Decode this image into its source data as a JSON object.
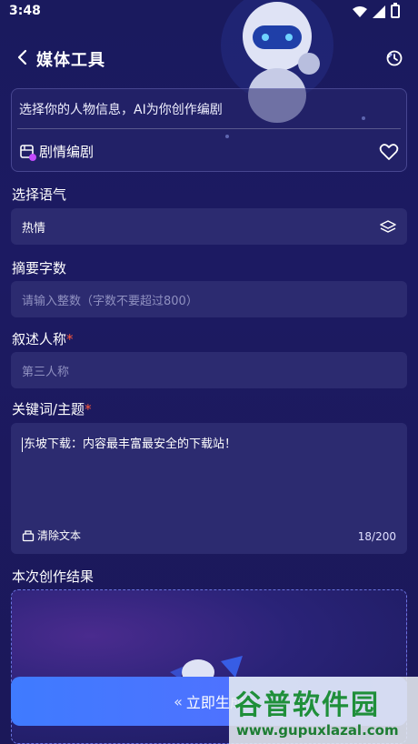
{
  "status": {
    "time": "3:48"
  },
  "header": {
    "title": "媒体工具"
  },
  "profile": {
    "hint": "选择你的人物信息，AI为你创作编剧",
    "role": "剧情编剧"
  },
  "tone": {
    "label": "选择语气",
    "value": "热情"
  },
  "summary": {
    "label": "摘要字数",
    "placeholder": "请输入整数（字数不要超过800）"
  },
  "narration": {
    "label": "叙述人称",
    "required_mark": "*",
    "placeholder": "第三人称"
  },
  "keywords": {
    "label": "关键词/主题",
    "required_mark": "*",
    "value": "东坡下载：内容最丰富最安全的下载站！",
    "clear_label": "清除文本",
    "count": "18/200"
  },
  "result": {
    "label": "本次创作结果"
  },
  "generate": {
    "label": "立即生成",
    "icon": "double-chevron-left"
  },
  "watermark": {
    "brand": "谷普软件园",
    "url": "www.gupuxlazal.com"
  },
  "colors": {
    "accent": "#4a78ff",
    "required": "#ff5a3c",
    "field_bg": "#2c2b70",
    "page_bg": "#1b1a5e"
  }
}
